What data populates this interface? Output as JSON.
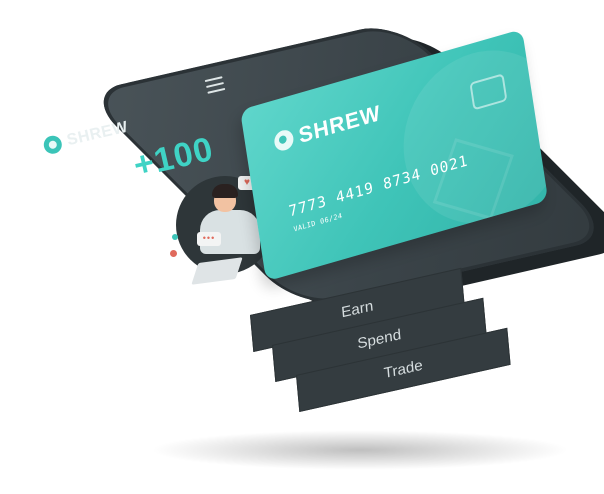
{
  "brand": {
    "name": "SHREW"
  },
  "phone_screen": {
    "bonus_text": "+100",
    "menu": [
      {
        "label": "Earn"
      },
      {
        "label": "Spend"
      },
      {
        "label": "Trade"
      }
    ]
  },
  "card": {
    "brand": "SHREW",
    "number": "7773 4419 8734 0021",
    "valid_label": "VALID 06/24"
  },
  "colors": {
    "accent": "#3fc4b8",
    "phone_body": "#3b4449",
    "bonus": "#3fd3c5"
  },
  "icons": [
    "shrew-logo-icon",
    "hamburger-menu-icon",
    "card-chip-icon",
    "heart-icon",
    "chat-dots-icon"
  ]
}
